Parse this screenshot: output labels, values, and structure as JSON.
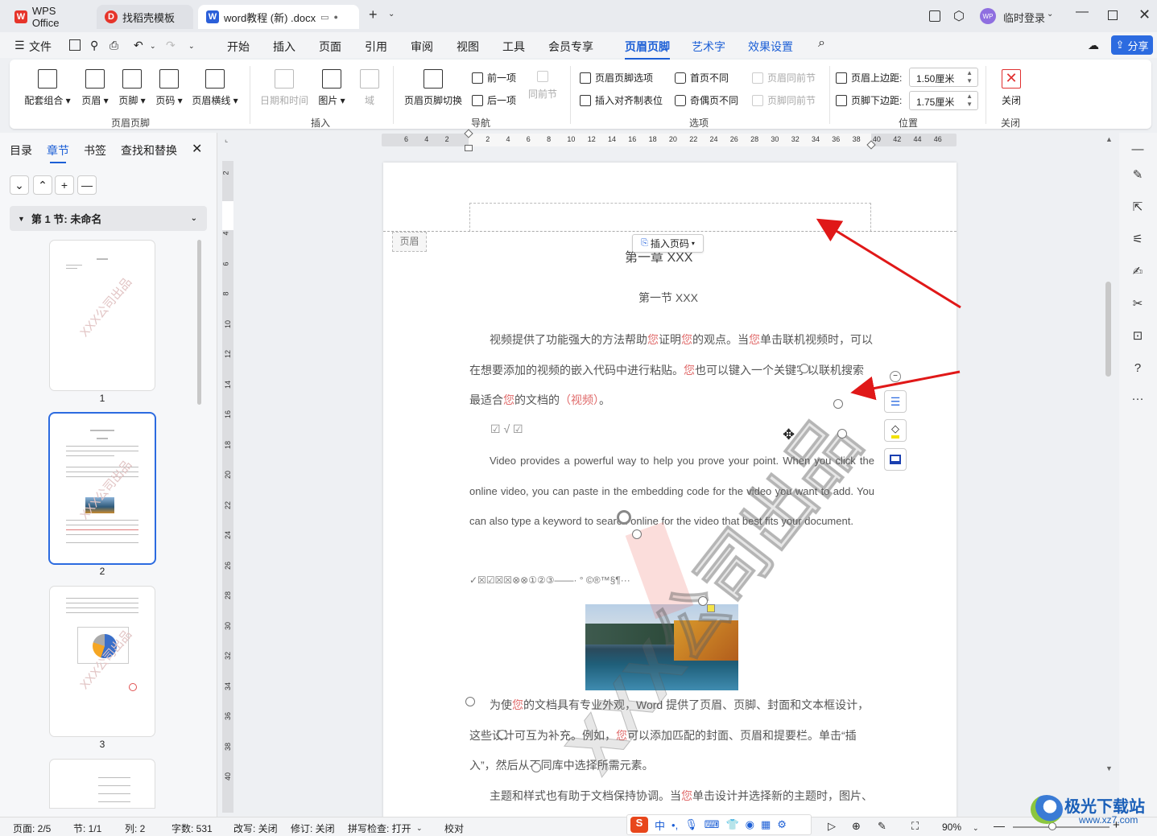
{
  "tabs": [
    {
      "label": "WPS Office",
      "logo": "W",
      "color": "#e6342a"
    },
    {
      "label": "找稻壳模板",
      "logo": "D",
      "color": "#e6342a"
    },
    {
      "label": "word教程 (新) .docx",
      "logo": "W",
      "color": "#2b5fd9"
    }
  ],
  "login_label": "临时登录",
  "avatar_text": "WP",
  "menus": [
    "文件",
    "开始",
    "插入",
    "页面",
    "引用",
    "审阅",
    "视图",
    "工具",
    "会员专享",
    "页眉页脚",
    "艺术字",
    "效果设置"
  ],
  "share_label": "分享",
  "ribbon": {
    "big": [
      "配套组合",
      "页眉",
      "页脚",
      "页码",
      "页眉横线",
      "日期和时间",
      "图片",
      "域",
      "页眉页脚切换",
      "关闭"
    ],
    "small": [
      "前一项",
      "后一项",
      "同前节",
      "页眉页脚选项",
      "插入对齐制表位",
      "首页不同",
      "奇偶页不同",
      "页眉同前节",
      "页脚同前节",
      "页眉上边距:",
      "页脚下边距:"
    ],
    "top_margin": "1.50厘米",
    "bottom_margin": "1.75厘米",
    "groups": [
      "页眉页脚",
      "插入",
      "导航",
      "选项",
      "位置",
      "关闭"
    ]
  },
  "left_panel": {
    "tabs": [
      "目录",
      "章节",
      "书签",
      "查找和替换"
    ],
    "section_label": "第 1 节: 未命名",
    "pages": [
      "1",
      "2",
      "3"
    ]
  },
  "ruler_h": [
    "6",
    "4",
    "2",
    "",
    "2",
    "4",
    "6",
    "8",
    "10",
    "12",
    "14",
    "16",
    "18",
    "20",
    "22",
    "24",
    "26",
    "28",
    "30",
    "32",
    "34",
    "36",
    "38",
    "40",
    "42",
    "44",
    "46"
  ],
  "ruler_v": [
    "2",
    "",
    "4",
    "6",
    "8",
    "10",
    "12",
    "14",
    "16",
    "18",
    "20",
    "22",
    "24",
    "26",
    "28",
    "30",
    "32",
    "34",
    "36",
    "38",
    "40"
  ],
  "document": {
    "header_tag": "页眉",
    "insert_page_number": "插入页码",
    "title_hidden": "第一章 XXX",
    "section_title": "第一节 XXX",
    "p1_a": "视频提供了功能强大的方法帮助",
    "you": "您",
    "p1_b": "证明",
    "p1_c": "的观点。当",
    "p1_d": "单击联机视频时，可以在想要添加的视频的嵌入代码中进行粘贴。",
    "p1_e": "也可以键入一个关键字以联机搜索最适合",
    "p1_f": "的文档的",
    "p1_g": "（视频）",
    "p1_h": "。",
    "checks": "☑   √   ☑",
    "english": "Video provides a powerful way to help you prove your point. When you click the online video, you can paste in the embedding code for the video you want to add. You can also type a keyword to search online for the video that best fits your document.",
    "symbols": "✓☒☑☒☒⊗⊗①②③——·  °  ©®™§¶···",
    "p3_a": "为使",
    "p3_b": "的文档具有专业外观，Word 提供了页眉、页脚、封面和文本框设计，这些设计可互为补充。例如，",
    "p3_c": "可以添加匹配的封面、页眉和提要栏。单击“插入”，然后从不同库中选择所需元素。",
    "p4_a": "主题和样式也有助于文档保持协调。当",
    "p4_b": "单击设计并选择新的主题时，图片、",
    "watermark": "XXX公司出品"
  },
  "status": {
    "page": "页面: 2/5",
    "section": "节: 1/1",
    "column": "列: 2",
    "words": "字数: 531",
    "rewrite": "改写: 关闭",
    "revise": "修订: 关闭",
    "spell": "拼写检查: 打开",
    "proof": "校对",
    "zoom": "90%",
    "ime": "中"
  },
  "watermark_site": "极光下载站",
  "watermark_url": "www.xz7.com"
}
